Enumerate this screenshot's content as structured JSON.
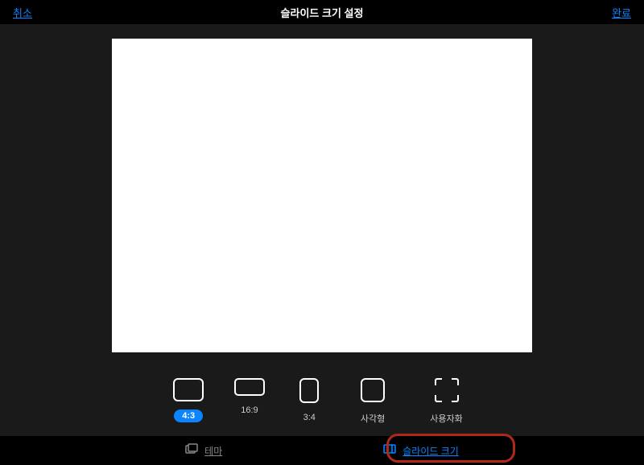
{
  "header": {
    "cancel_label": "취소",
    "title": "슬라이드 크기 설정",
    "done_label": "완료"
  },
  "ratios": [
    {
      "id": "4-3",
      "label": "4:3",
      "selected": true
    },
    {
      "id": "16-9",
      "label": "16:9",
      "selected": false
    },
    {
      "id": "3-4",
      "label": "3:4",
      "selected": false
    },
    {
      "id": "square",
      "label": "사각형",
      "selected": false
    },
    {
      "id": "custom",
      "label": "사용자화",
      "selected": false
    }
  ],
  "footer": {
    "theme_label": "테마",
    "size_label": "슬라이드 크기"
  },
  "colors": {
    "accent": "#0a84ff",
    "highlight": "#b0281a"
  }
}
